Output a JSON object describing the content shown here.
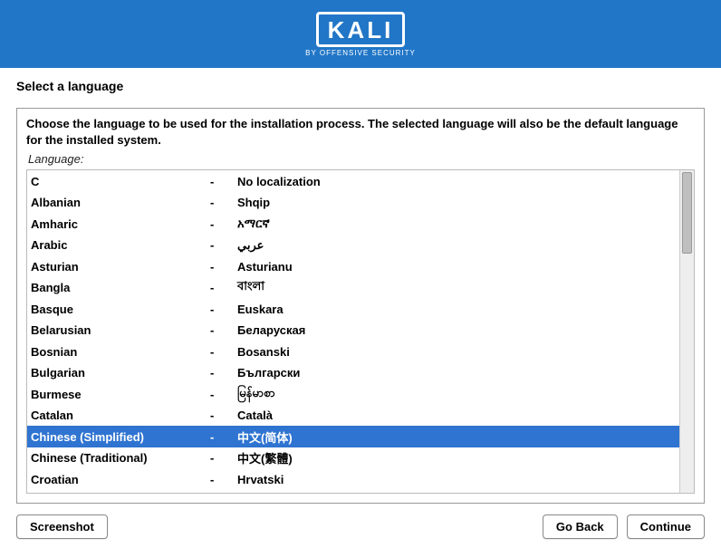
{
  "header": {
    "logo_text": "KALI",
    "logo_subtitle": "BY OFFENSIVE SECURITY"
  },
  "page": {
    "title": "Select a language",
    "instruction": "Choose the language to be used for the installation process. The selected language will also be the default language for the installed system.",
    "field_label": "Language:"
  },
  "languages": [
    {
      "name": "C",
      "native": "No localization",
      "selected": false
    },
    {
      "name": "Albanian",
      "native": "Shqip",
      "selected": false
    },
    {
      "name": "Amharic",
      "native": "አማርኛ",
      "selected": false
    },
    {
      "name": "Arabic",
      "native": "عربي",
      "selected": false
    },
    {
      "name": "Asturian",
      "native": "Asturianu",
      "selected": false
    },
    {
      "name": "Bangla",
      "native": "বাংলা",
      "selected": false
    },
    {
      "name": "Basque",
      "native": "Euskara",
      "selected": false
    },
    {
      "name": "Belarusian",
      "native": "Беларуская",
      "selected": false
    },
    {
      "name": "Bosnian",
      "native": "Bosanski",
      "selected": false
    },
    {
      "name": "Bulgarian",
      "native": "Български",
      "selected": false
    },
    {
      "name": "Burmese",
      "native": "မြန်မာစာ",
      "selected": false
    },
    {
      "name": "Catalan",
      "native": "Català",
      "selected": false
    },
    {
      "name": "Chinese (Simplified)",
      "native": "中文(简体)",
      "selected": true
    },
    {
      "name": "Chinese (Traditional)",
      "native": "中文(繁體)",
      "selected": false
    },
    {
      "name": "Croatian",
      "native": "Hrvatski",
      "selected": false
    }
  ],
  "separator": "-",
  "footer": {
    "screenshot": "Screenshot",
    "go_back": "Go Back",
    "continue": "Continue"
  }
}
